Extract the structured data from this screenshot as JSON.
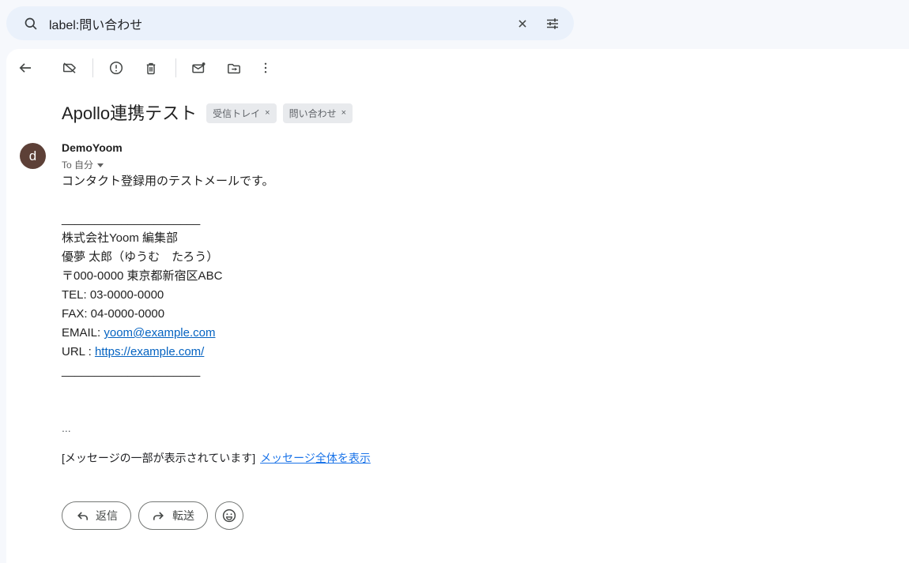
{
  "search": {
    "value": "label:問い合わせ",
    "icons": [
      "search-icon",
      "clear-icon",
      "search-options-icon"
    ]
  },
  "toolbar": {
    "icons": [
      "back-arrow",
      "remove-label",
      "report-spam",
      "delete",
      "mark-unread",
      "move-to",
      "more-options"
    ]
  },
  "email": {
    "subject": "Apollo連携テスト",
    "labels": [
      {
        "text": "受信トレイ"
      },
      {
        "text": "問い合わせ"
      }
    ],
    "chip_remove": "×",
    "sender": {
      "name": "DemoYoom",
      "avatar_letter": "d",
      "to": "To 自分"
    },
    "body": {
      "intro": "コンタクト登録用のテストメールです。",
      "separator": "_____________________",
      "signature": [
        "株式会社Yoom 編集部",
        "優夢 太郎（ゆうむ　たろう）",
        "〒000-0000 東京都新宿区ABC",
        "TEL: 03-0000-0000",
        "FAX: 04-0000-0000"
      ],
      "email_label": "EMAIL: ",
      "email_link": "yoom@example.com",
      "url_label": "URL : ",
      "url_link": "https://example.com/",
      "ellipsis": "...",
      "truncation_notice": "[メッセージの一部が表示されています]",
      "show_full_message": "メッセージ全体を表示"
    },
    "actions": {
      "reply": "返信",
      "forward": "転送"
    }
  },
  "colors": {
    "header_bg": "#f6f8fc",
    "search_bg": "#eaf1fb",
    "card_bg": "#ffffff",
    "icon": "#444746",
    "avatar_bg": "#5d4037",
    "chip_bg": "#e8eaed",
    "chip_text": "#5f6368",
    "body_link": "#0563c1",
    "notice_link": "#1a73e8",
    "text_primary": "#1f1f1f"
  }
}
